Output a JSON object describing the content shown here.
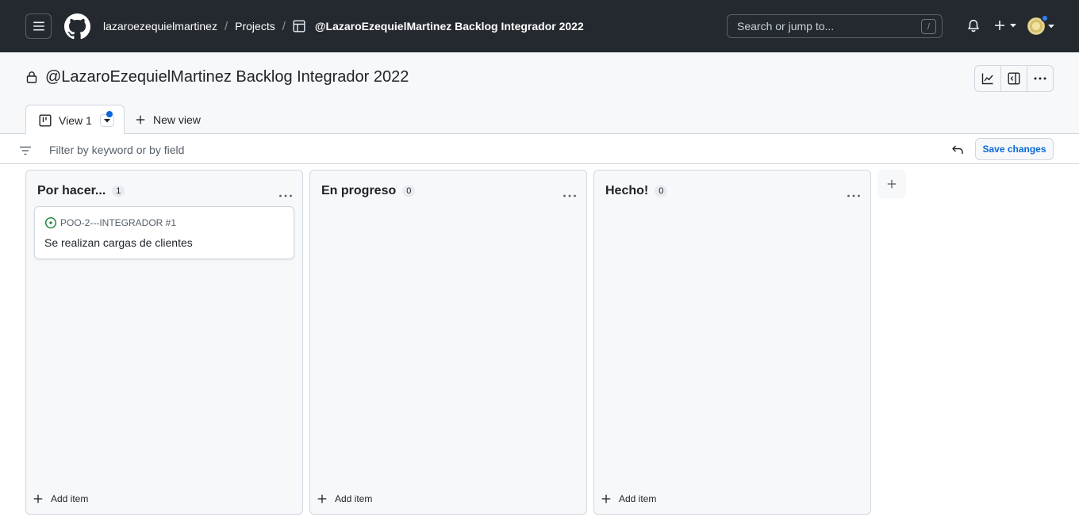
{
  "topbar": {
    "breadcrumb_user": "lazaroezequielmartinez",
    "breadcrumb_separator": "/",
    "breadcrumb_projects": "Projects",
    "breadcrumb_project": "@LazaroEzequielMartinez Backlog Integrador 2022",
    "search_placeholder": "Search or jump to...",
    "search_shortcut": "/"
  },
  "project": {
    "title": "@LazaroEzequielMartinez Backlog Integrador 2022",
    "tabs": [
      {
        "label": "View 1",
        "active": true,
        "has_unsaved_dot": true
      }
    ],
    "new_view_label": "New view"
  },
  "filter": {
    "placeholder": "Filter by keyword or by field",
    "save_label": "Save changes"
  },
  "columns": [
    {
      "title": "Por hacer...",
      "count": "1",
      "add_label": "Add item",
      "cards": [
        {
          "repo": "POO-2---INTEGRADOR #1",
          "title": "Se realizan cargas de clientes",
          "status_icon": "issue-opened-icon"
        }
      ]
    },
    {
      "title": "En progreso",
      "count": "0",
      "add_label": "Add item",
      "cards": []
    },
    {
      "title": "Hecho!",
      "count": "0",
      "add_label": "Add item",
      "cards": []
    }
  ],
  "colors": {
    "header_bg": "#24292f",
    "accent": "#0969da",
    "issue_open": "#1a7f37",
    "column_bg": "#f6f8fa",
    "border": "#d0d7de"
  }
}
